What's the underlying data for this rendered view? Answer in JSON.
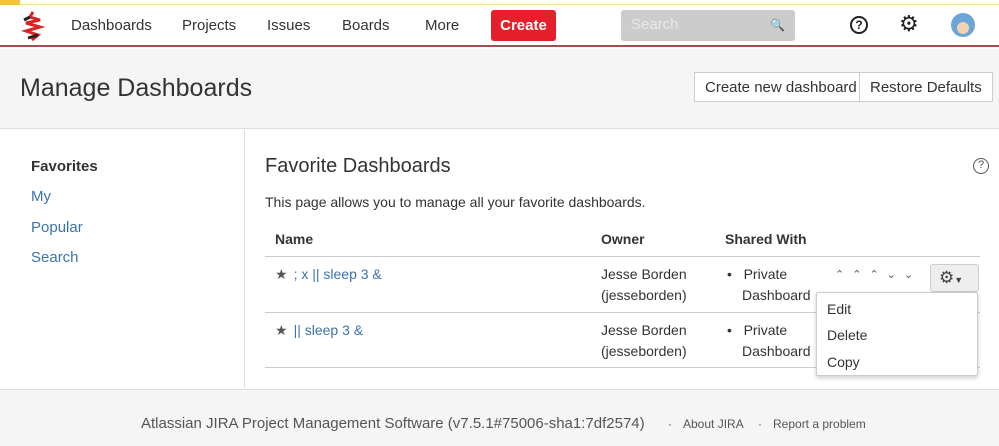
{
  "nav": {
    "items": [
      "Dashboards",
      "Projects",
      "Issues",
      "Boards",
      "More"
    ],
    "create": "Create",
    "search_placeholder": "Search"
  },
  "header": {
    "title": "Manage Dashboards",
    "create_btn": "Create new dashboard",
    "restore_btn": "Restore Defaults"
  },
  "sidebar": {
    "items": [
      "Favorites",
      "My",
      "Popular",
      "Search"
    ]
  },
  "main": {
    "title": "Favorite Dashboards",
    "description": "This page allows you to manage all your favorite dashboards.",
    "columns": [
      "Name",
      "Owner",
      "Shared With"
    ],
    "rows": [
      {
        "name": "; x || sleep 3 &",
        "owner": "Jesse Borden",
        "owner_user": "(jesseborden)",
        "shared": "Private",
        "shared2": "Dashboard"
      },
      {
        "name": "|| sleep 3 &",
        "owner": "Jesse Borden",
        "owner_user": "(jesseborden)",
        "shared": "Private",
        "shared2": "Dashboard"
      }
    ]
  },
  "menu": {
    "items": [
      "Edit",
      "Delete",
      "Copy"
    ]
  },
  "footer": {
    "text": "Atlassian JIRA Project Management Software (v7.5.1#75006-sha1:7df2574)",
    "about": "About JIRA",
    "report": "Report a problem"
  },
  "colors": {
    "create": "#e5202a",
    "link": "#3b73af"
  }
}
